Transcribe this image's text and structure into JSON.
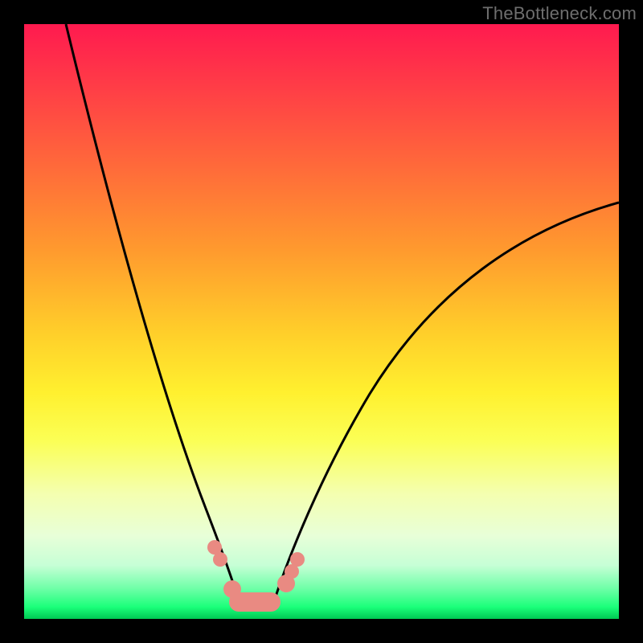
{
  "watermark": {
    "text": "TheBottleneck.com"
  },
  "colors": {
    "black": "#000000",
    "bead": "#e98a82",
    "curve": "#000000",
    "watermark": "#6e6e6e"
  },
  "chart_data": {
    "type": "line",
    "title": "",
    "xlabel": "",
    "ylabel": "",
    "xlim": [
      0,
      100
    ],
    "ylim": [
      0,
      100
    ],
    "grid": false,
    "legend": false,
    "annotations": [
      "TheBottleneck.com"
    ],
    "series": [
      {
        "name": "left-arm",
        "x": [
          7,
          10,
          14,
          18,
          22,
          25,
          28,
          30,
          32,
          34,
          35,
          36
        ],
        "values": [
          100,
          86,
          71,
          57,
          43,
          33,
          24,
          17,
          12,
          7,
          5,
          3
        ]
      },
      {
        "name": "right-arm",
        "x": [
          42,
          44,
          47,
          51,
          56,
          63,
          72,
          83,
          95,
          100
        ],
        "values": [
          3,
          6,
          11,
          18,
          26,
          36,
          47,
          57,
          66,
          70
        ]
      }
    ],
    "trough": {
      "x_range": [
        36,
        42
      ],
      "value": 3
    },
    "markers": [
      {
        "arm": "left",
        "x": 32,
        "y": 12,
        "size": "sm"
      },
      {
        "arm": "left",
        "x": 33,
        "y": 10,
        "size": "sm"
      },
      {
        "arm": "left",
        "x": 35,
        "y": 5,
        "size": "md"
      },
      {
        "arm": "right",
        "x": 44,
        "y": 6,
        "size": "md"
      },
      {
        "arm": "right",
        "x": 45,
        "y": 8,
        "size": "sm"
      },
      {
        "arm": "right",
        "x": 46,
        "y": 10,
        "size": "sm"
      }
    ],
    "background_gradient": {
      "top": "#ff1a4f",
      "mid": "#fff02f",
      "bottom": "#00c853"
    }
  }
}
